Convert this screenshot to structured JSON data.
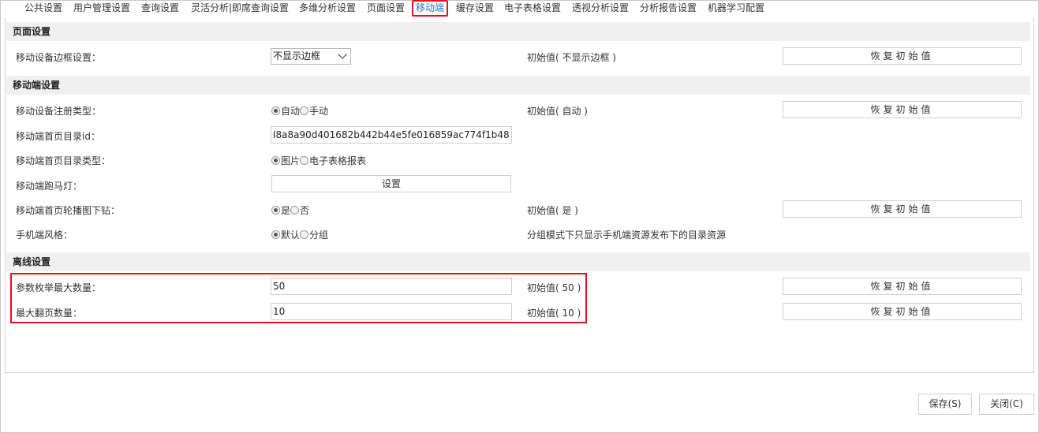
{
  "tabs": [
    "公共设置",
    "用户管理设置",
    "查询设置",
    "灵活分析|即席查询设置",
    "多维分析设置",
    "页面设置",
    "移动端",
    "缓存设置",
    "电子表格设置",
    "透视分析设置",
    "分析报告设置",
    "机器学习配置"
  ],
  "active_tab": "移动端",
  "sections": {
    "page": "页面设置",
    "mobile": "移动端设置",
    "offline": "离线设置"
  },
  "rows": {
    "border": {
      "label": "移动设备边框设置：",
      "value": "不显示边框",
      "initial": "初始值( 不显示边框 )",
      "reset": "恢复初始值"
    },
    "register": {
      "label": "移动设备注册类型：",
      "options": [
        "自动",
        "手动"
      ],
      "initial": "初始值( 自动 )",
      "reset": "恢复初始值"
    },
    "home_dir_id": {
      "label": "移动端首页目录id：",
      "value": "I8a8a90d401682b442b44e5fe016859ac774f1b48"
    },
    "home_dir_type": {
      "label": "移动端首页目录类型：",
      "options": [
        "图片",
        "电子表格报表"
      ]
    },
    "marquee": {
      "label": "移动端跑马灯：",
      "button": "设置"
    },
    "carousel": {
      "label": "移动端首页轮播图下钻：",
      "options": [
        "是",
        "否"
      ],
      "initial": "初始值( 是 )",
      "reset": "恢复初始值"
    },
    "phone_style": {
      "label": "手机端风格：",
      "options": [
        "默认",
        "分组"
      ],
      "note": "分组模式下只显示手机端资源发布下的目录资源"
    },
    "param_enum": {
      "label": "参数枚举最大数量：",
      "value": "50",
      "initial": "初始值( 50 )",
      "reset": "恢复初始值"
    },
    "max_pages": {
      "label": "最大翻页数量：",
      "value": "10",
      "initial": "初始值( 10 )",
      "reset": "恢复初始值"
    }
  },
  "footer": {
    "save": "保存(S)",
    "close": "关闭(C)"
  }
}
